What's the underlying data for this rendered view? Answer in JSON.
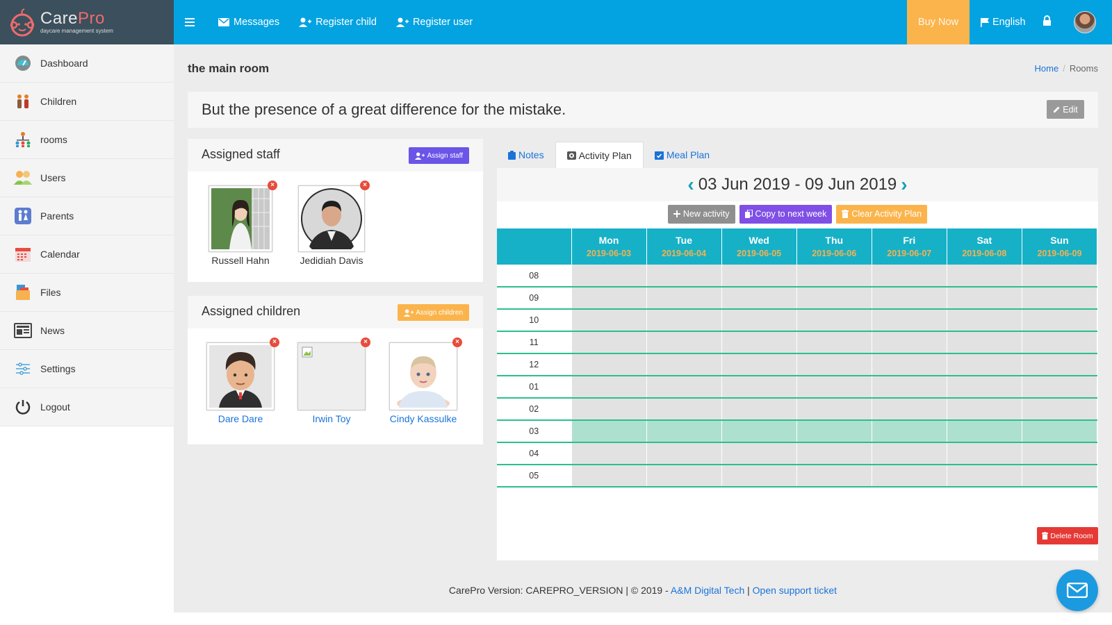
{
  "app": {
    "logo_title_a": "Care",
    "logo_title_b": "Pro",
    "logo_subtitle": "daycare management system"
  },
  "topnav": {
    "messages": "Messages",
    "register_child": "Register child",
    "register_user": "Register user",
    "buy_now": "Buy Now",
    "language": "English"
  },
  "sidebar": {
    "items": [
      {
        "label": "Dashboard",
        "icon": "dashboard-icon"
      },
      {
        "label": "Children",
        "icon": "children-icon"
      },
      {
        "label": "rooms",
        "icon": "rooms-icon"
      },
      {
        "label": "Users",
        "icon": "users-icon"
      },
      {
        "label": "Parents",
        "icon": "parents-icon"
      },
      {
        "label": "Calendar",
        "icon": "calendar-icon"
      },
      {
        "label": "Files",
        "icon": "files-icon"
      },
      {
        "label": "News",
        "icon": "news-icon"
      },
      {
        "label": "Settings",
        "icon": "settings-icon"
      },
      {
        "label": "Logout",
        "icon": "power-icon"
      }
    ]
  },
  "page": {
    "title": "the main room",
    "breadcrumb": {
      "home": "Home",
      "current": "Rooms"
    },
    "headline": "But the presence of a great difference for the mistake.",
    "edit": "Edit"
  },
  "staff": {
    "title": "Assigned staff",
    "button": "Assign staff",
    "members": [
      {
        "name": "Russell Hahn"
      },
      {
        "name": "Jedidiah Davis"
      }
    ]
  },
  "children": {
    "title": "Assigned children",
    "button": "Assign children",
    "members": [
      {
        "name": "Dare Dare"
      },
      {
        "name": "Irwin Toy"
      },
      {
        "name": "Cindy Kassulke"
      }
    ]
  },
  "tabs": [
    {
      "label": "Notes"
    },
    {
      "label": "Activity Plan"
    },
    {
      "label": "Meal Plan"
    }
  ],
  "activity": {
    "range": "03 Jun 2019 - 09 Jun 2019",
    "new_activity": "New activity",
    "copy_next": "Copy to next week",
    "clear": "Clear Activity Plan",
    "days": [
      {
        "name": "Mon",
        "date": "2019-06-03"
      },
      {
        "name": "Tue",
        "date": "2019-06-04"
      },
      {
        "name": "Wed",
        "date": "2019-06-05"
      },
      {
        "name": "Thu",
        "date": "2019-06-06"
      },
      {
        "name": "Fri",
        "date": "2019-06-07"
      },
      {
        "name": "Sat",
        "date": "2019-06-08"
      },
      {
        "name": "Sun",
        "date": "2019-06-09"
      }
    ],
    "hours": [
      "08",
      "09",
      "10",
      "11",
      "12",
      "01",
      "02",
      "03",
      "04",
      "05"
    ],
    "highlight_hour": "03"
  },
  "delete_room": "Delete Room",
  "footer": {
    "version": "CarePro Version: CAREPRO_VERSION | © 2019 -",
    "company": "A&M Digital Tech",
    "sep": "|",
    "support": "Open support ticket"
  },
  "colors": {
    "topbar": "#03a3e1",
    "buy_now": "#fbb44c",
    "calendar_header": "#16b1c7",
    "date_text": "#f6b150",
    "row_border": "#2bbf8e",
    "highlight_row": "#aee0cf",
    "assign_staff": "#6a55e8",
    "assign_children": "#fbb44c",
    "delete": "#e53935"
  }
}
